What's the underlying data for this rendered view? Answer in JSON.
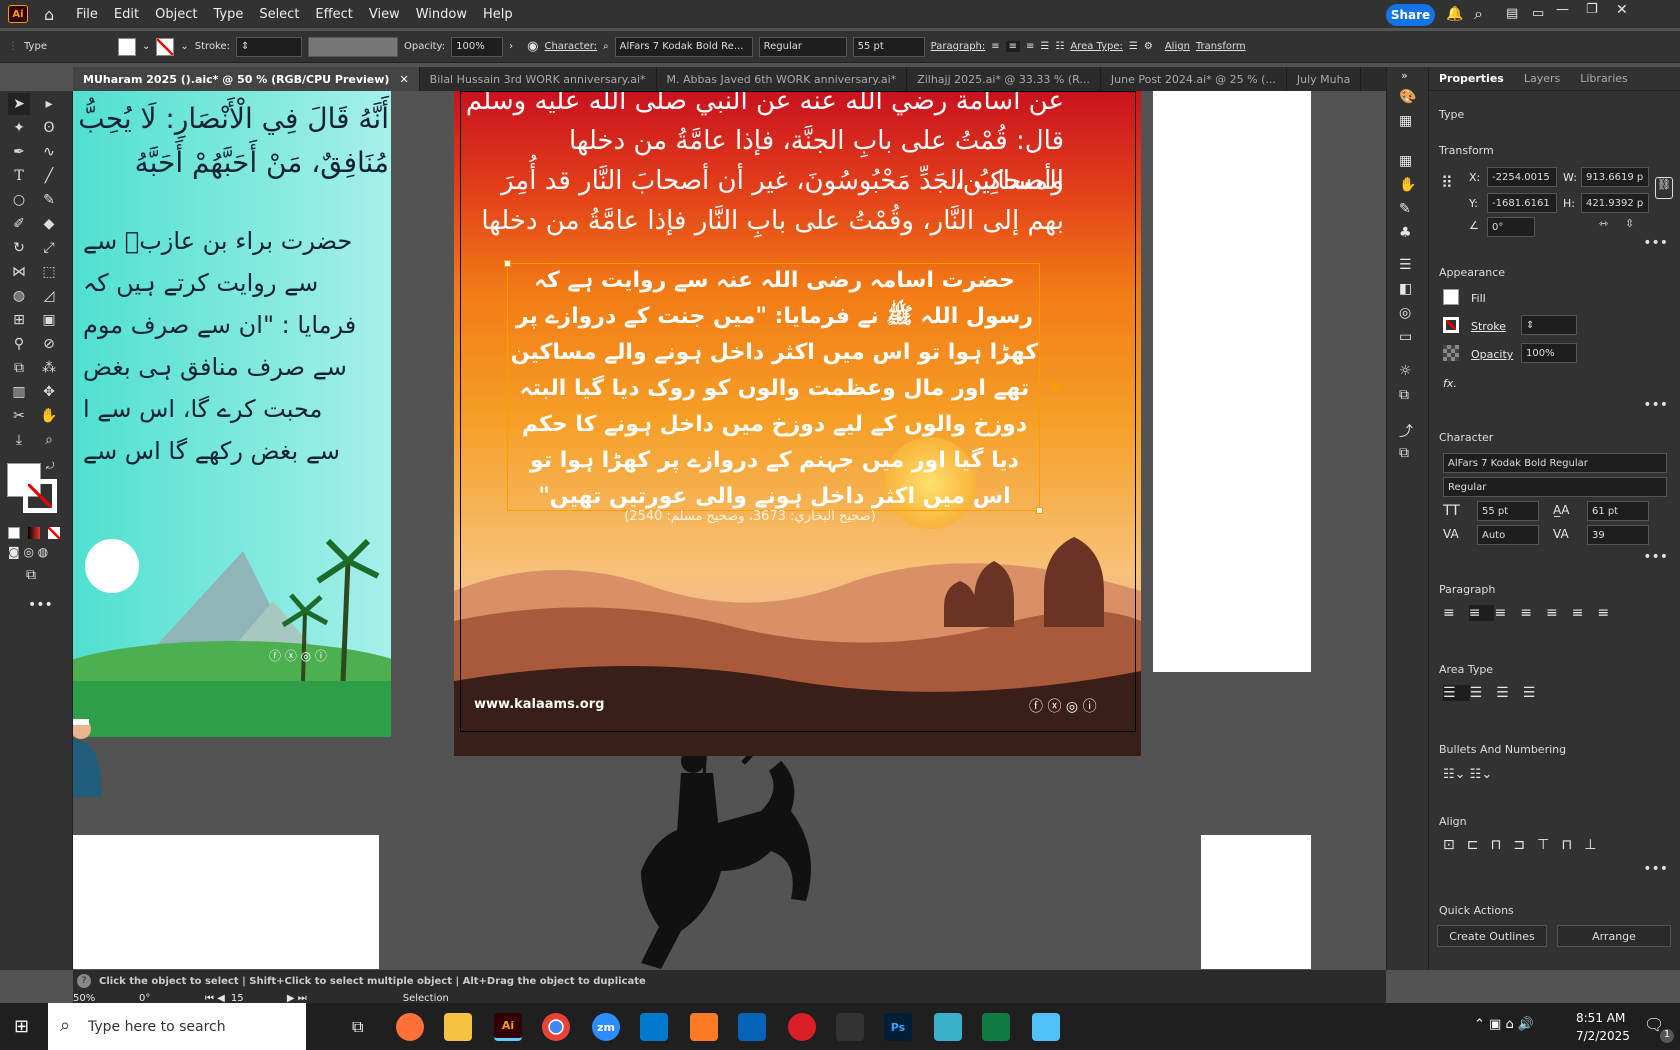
{
  "app": {
    "logo_text": "Ai"
  },
  "menu": [
    "File",
    "Edit",
    "Object",
    "Type",
    "Select",
    "Effect",
    "View",
    "Window",
    "Help"
  ],
  "share_label": "Share",
  "control_bar": {
    "type_label": "Type",
    "stroke_label": "Stroke:",
    "opacity_label": "Opacity:",
    "opacity_value": "100%",
    "character_label": "Character:",
    "font_name": "AlFars 7 Kodak Bold Re...",
    "font_style": "Regular",
    "font_size": "55 pt",
    "paragraph_label": "Paragraph:",
    "area_type_label": "Area Type:",
    "align_label": "Align",
    "transform_label": "Transform"
  },
  "tabs": [
    {
      "label": "MUharam 2025 ().aic* @ 50 % (RGB/CPU Preview)",
      "active": true
    },
    {
      "label": "Bilal Hussain  3rd  WORK anniversary.ai*",
      "active": false
    },
    {
      "label": "M. Abbas Javed  6th  WORK anniversary.ai*",
      "active": false
    },
    {
      "label": "Zilhajj 2025.ai* @ 33.33 % (R...",
      "active": false
    },
    {
      "label": "June Post 2024.ai* @ 25 % (...",
      "active": false
    },
    {
      "label": "July Muha",
      "active": false
    }
  ],
  "left_artboard": {
    "arabic_lines": [
      "أَنَّهُ قَالَ فِي الْأَنْصَارِ: لَا يُحِبُّ",
      "مُنَافِقٌ، مَنْ أَحَبَّهُمْ أَحَبَّهُ"
    ],
    "urdu_lines": [
      "حضرت براء بن عازبؓ سے",
      "سے روایت کرتے ہیں کہ",
      "فرمایا : \"ان سے صرف موم",
      "سے صرف منافق ہی بغض",
      "محبت کرے گا، اس سے ا",
      "سے بغض رکھے گا اس سے"
    ]
  },
  "main_artboard": {
    "arabic_lines": [
      "عن أسامة رضي الله عنه عن النبي صلى الله عليه وسلم",
      "قال: قُمْتُ على بابِ الجنَّة، فإذا عامَّةُ من دخلها المساكِين،",
      "وأصحابُ الجَدِّ مَحْبُوسُونَ، غير أن أصحابَ النَّار قد أُمِرَ",
      "بهم إلى النَّار، وقُمْتُ على بابِ النَّار فإذا عامَّةُ من دخلها"
    ],
    "urdu_lines": [
      "حضرت اسامہ رضی اللہ عنہ سے روایت ہے کہ",
      "رسول اللہ ﷺ نے فرمایا: \"میں جنت کے دروازے پر",
      "کھڑا ہوا تو اس میں اکثر داخل ہونے والے مساکین",
      "تھے اور مال وعظمت والوں کو روک دیا گیا البتہ",
      "دوزخ والوں کے لیے دوزخ میں داخل ہونے کا حکم",
      "دیا گیا اور میں جہنم کے دروازے پر کھڑا ہوا تو",
      "اس میں اکثر داخل ہونے والی عورتیں تھیں\""
    ],
    "reference": "(صحيح البخاري: 3673، وصحيح مسلم: 2540)",
    "website": "www.kalaams.org"
  },
  "panel": {
    "tabs": [
      "Properties",
      "Layers",
      "Libraries"
    ],
    "type_heading": "Type",
    "transform_heading": "Transform",
    "x_label": "X:",
    "x_value": "-2254.0015",
    "w_label": "W:",
    "w_value": "913.6619 p",
    "y_label": "Y:",
    "y_value": "-1681.6161",
    "h_label": "H:",
    "h_value": "421.9392 p",
    "angle_value": "0°",
    "appearance_heading": "Appearance",
    "fill_label": "Fill",
    "stroke_label": "Stroke",
    "opacity_label": "Opacity",
    "opacity_value": "100%",
    "fx_label": "fx.",
    "character_heading": "Character",
    "font_name": "AlFars 7 Kodak Bold Regular",
    "font_style": "Regular",
    "font_size": "55 pt",
    "leading": "61 pt",
    "kerning": "Auto",
    "tracking": "39",
    "paragraph_heading": "Paragraph",
    "area_type_heading": "Area Type",
    "bullets_heading": "Bullets And Numbering",
    "align_heading": "Align",
    "quick_actions_heading": "Quick Actions",
    "create_outlines_label": "Create Outlines",
    "arrange_label": "Arrange"
  },
  "status": {
    "hint": "Click the object to select  |  Shift+Click to select multiple object  |  Alt+Drag the object to duplicate",
    "zoom": "50%",
    "rotation": "0°",
    "artboard_num": "15",
    "tool_name": "Selection"
  },
  "taskbar": {
    "search_placeholder": "Type here to search",
    "time": "8:51 AM",
    "date": "7/2/2025",
    "notif_count": "1",
    "apps": [
      "Firefox",
      "Explorer",
      "Ai",
      "Chrome",
      "zm",
      "VSCode",
      "XAMPP",
      "Outlook",
      "Creative Cloud",
      "Pen",
      "Ps",
      "App",
      "Excel",
      "Notepad"
    ]
  }
}
